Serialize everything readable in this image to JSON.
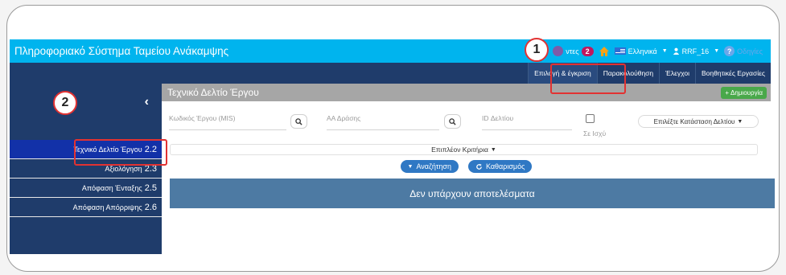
{
  "app": {
    "title": "Πληροφοριακό Σύστημα Ταμείου Ανάκαμψης"
  },
  "topbar": {
    "messages_label": "ντες",
    "messages_count": "2",
    "language_label": "Ελληνικά",
    "user_label": "RRF_16",
    "help_label": "Οδηγίες"
  },
  "nav": {
    "tabs": [
      {
        "label": "Επιλογή & έγκριση"
      },
      {
        "label": "Παρακολούθηση"
      },
      {
        "label": "Έλεγχοι"
      },
      {
        "label": "Βοηθητικές Εργασίες"
      }
    ]
  },
  "sidebar": {
    "collapse_glyph": "‹",
    "items": [
      {
        "label": "Τεχνικό Δελτίο Έργου",
        "number": "2.2"
      },
      {
        "label": "Αξιολόγηση",
        "number": "2.3"
      },
      {
        "label": "Απόφαση Ένταξης",
        "number": "2.5"
      },
      {
        "label": "Απόφαση Απόρριψης",
        "number": "2.6"
      }
    ]
  },
  "main": {
    "section_title": "Τεχνικό Δελτίο Έργου",
    "create_label": "Δημιουργία",
    "filters": {
      "project_code_placeholder": "Κωδικός Έργου (MIS)",
      "action_no_placeholder": "ΑΑ Δράσης",
      "sheet_id_placeholder": "ID Δελτίου",
      "valid_label": "Σε Ισχύ",
      "status_select": "Επιλέξτε Κατάσταση Δελτίου"
    },
    "more_criteria": "Επιπλέον Κριτήρια",
    "search_button": "Αναζήτηση",
    "clear_button": "Καθαρισμός",
    "no_results": "Δεν υπάρχουν αποτελέσματα"
  },
  "annotations": {
    "marker_1": "1",
    "marker_2": "2"
  },
  "colors": {
    "topbar": "#00b4ee",
    "navbar": "#1f3c6b",
    "sidebar_active": "#1231a8",
    "highlight": "#e23232",
    "create_button": "#49a84a",
    "primary_button": "#2f78c4",
    "no_results_banner": "#4d7aa3"
  }
}
